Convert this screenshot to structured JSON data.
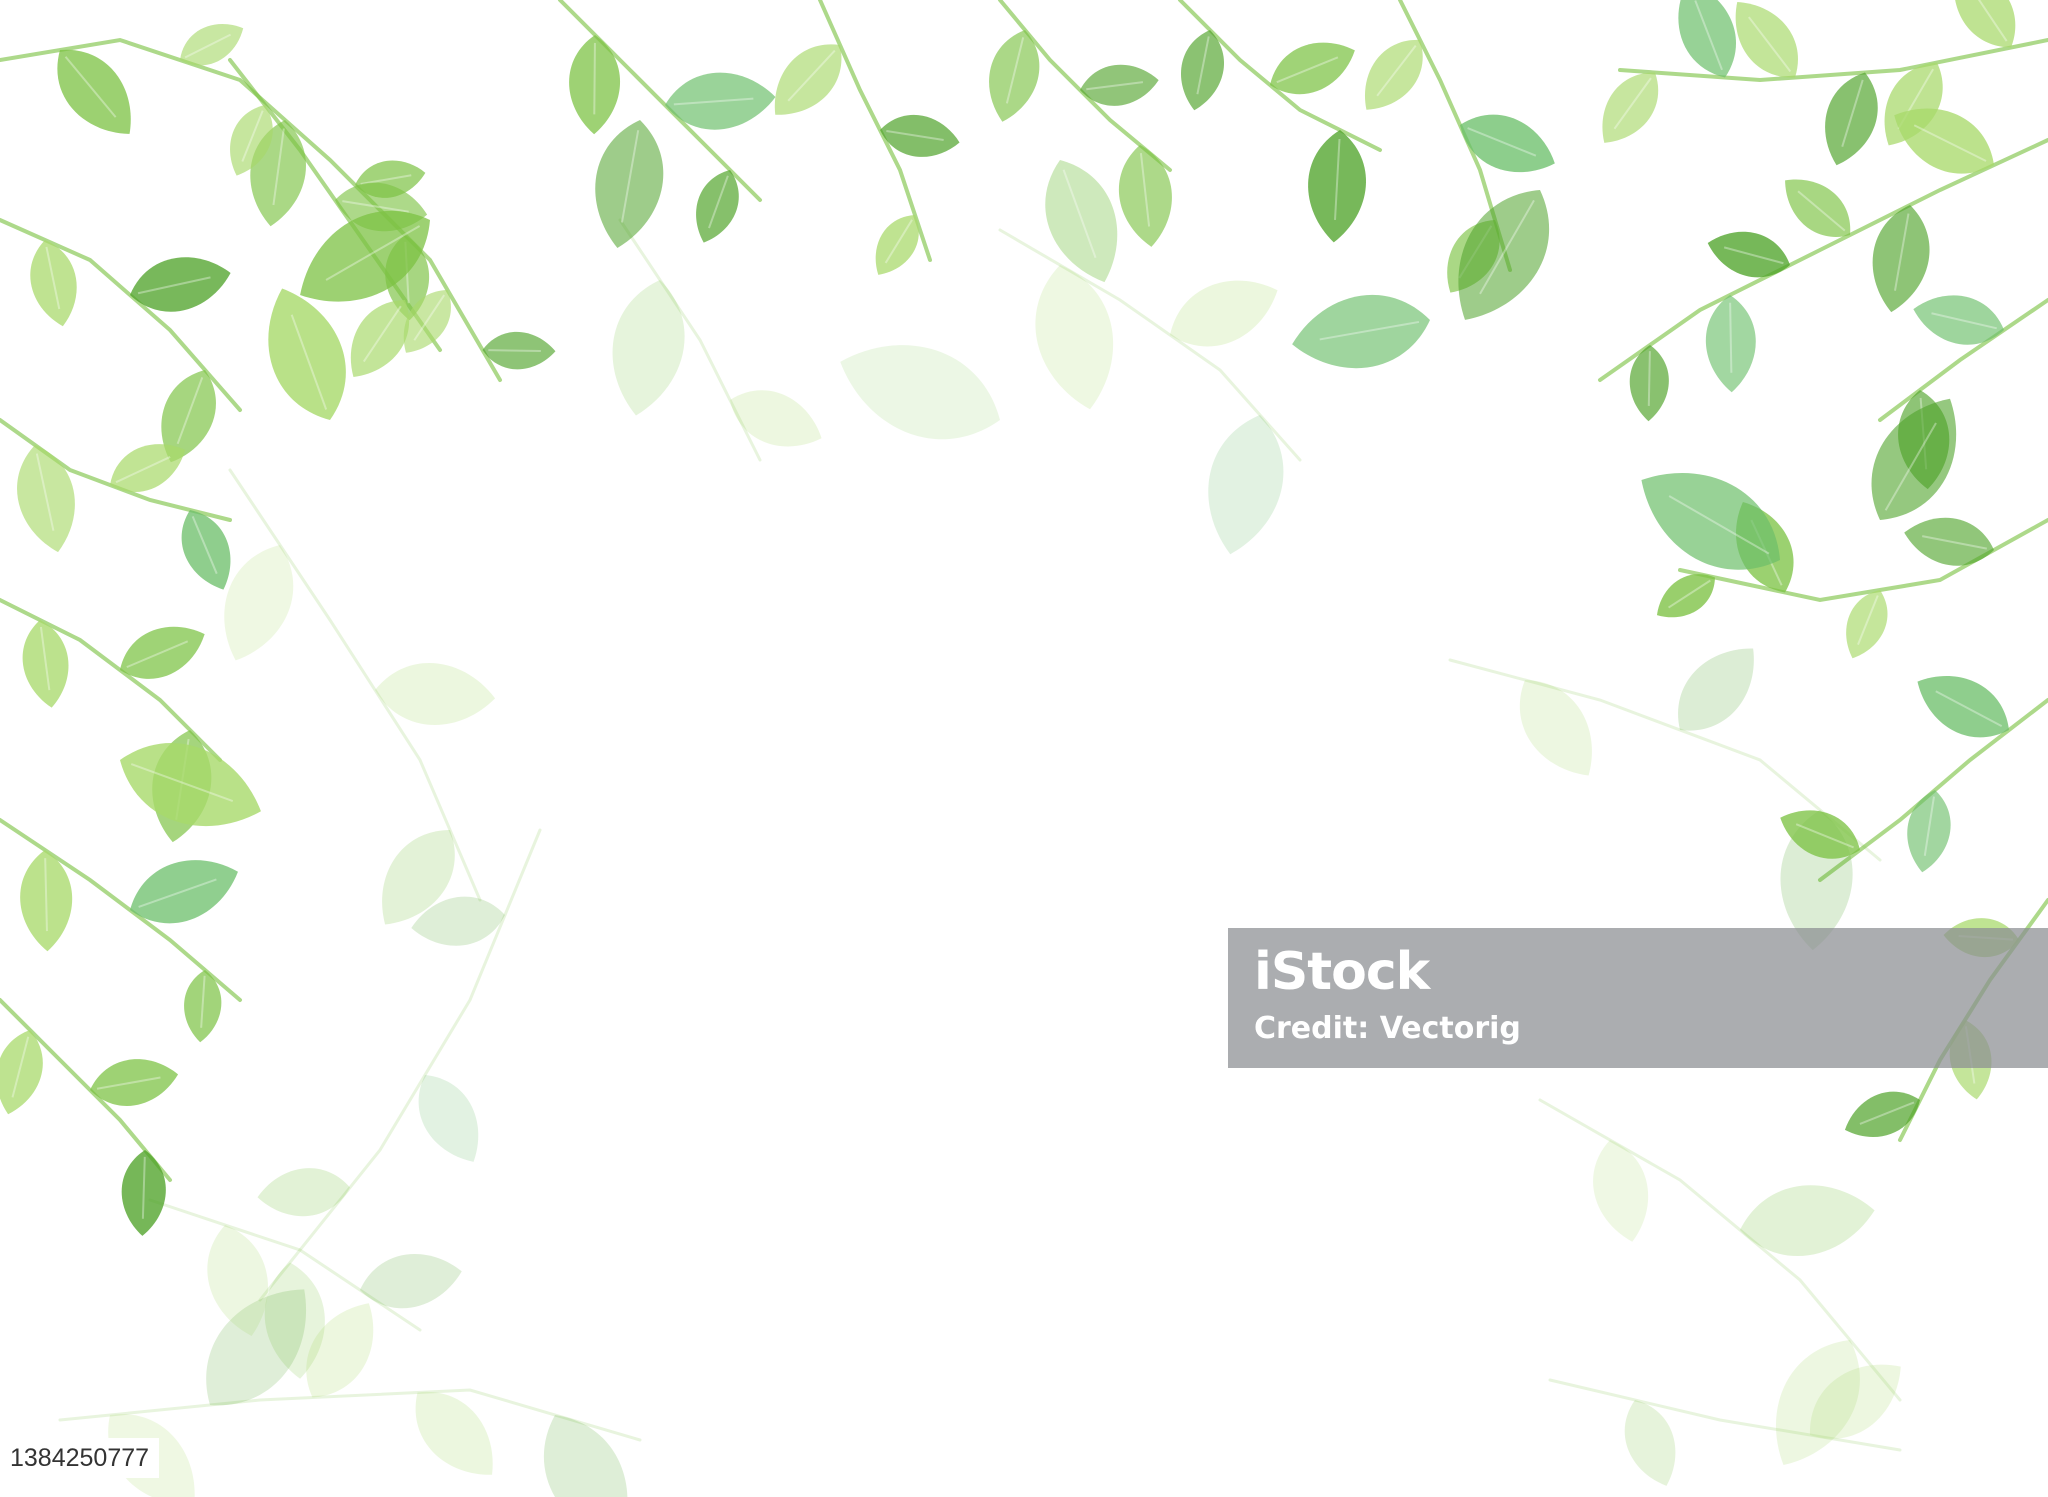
{
  "image": {
    "subject": "green-leaf-frame",
    "background_color": "#ffffff",
    "palette": {
      "light_green": "#a8d96a",
      "mid_green": "#7cc243",
      "deep_green": "#4fa329",
      "sea_green": "#6cbf6a",
      "pale_green": "#c9e7b5"
    }
  },
  "watermark": {
    "logo": "iStock",
    "credit": "Credit: Vectorig"
  },
  "image_id": "1384250777"
}
